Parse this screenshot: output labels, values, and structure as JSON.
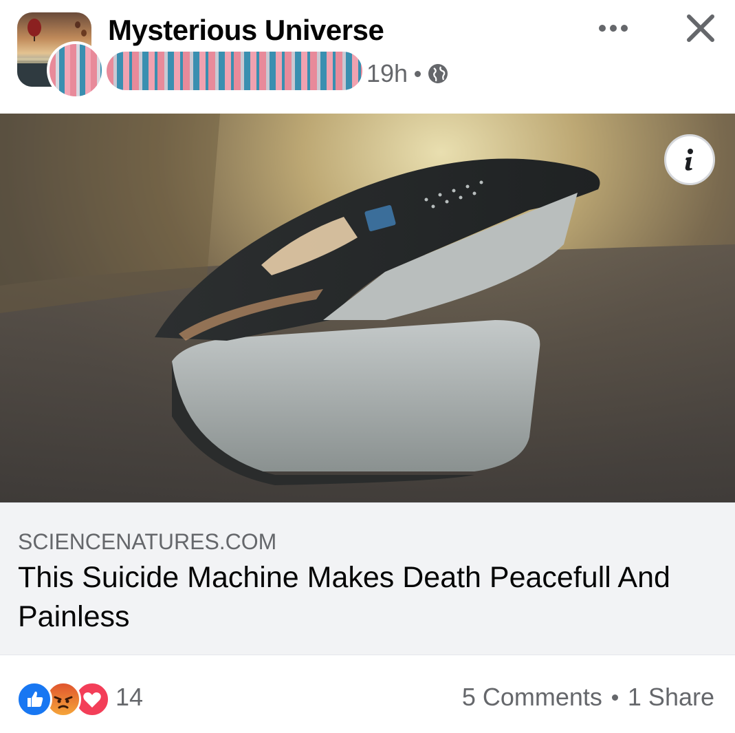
{
  "post": {
    "page_name": "Mysterious Universe",
    "timestamp": "19h",
    "audience_icon": "globe-icon",
    "more_icon": "more-options-icon",
    "close_icon": "close-icon"
  },
  "media": {
    "info_icon": "info-icon"
  },
  "link": {
    "domain": "SCIENCENATURES.COM",
    "title": "This Suicide Machine Makes Death Peacefull And Painless"
  },
  "footer": {
    "reactions": [
      "like",
      "angry",
      "love"
    ],
    "reaction_count": "14",
    "comments": "5 Comments",
    "shares": "1 Share"
  },
  "colors": {
    "like": "#1877f2",
    "angry": "#f0842c",
    "love": "#f33e58",
    "secondary_text": "#65676b"
  }
}
